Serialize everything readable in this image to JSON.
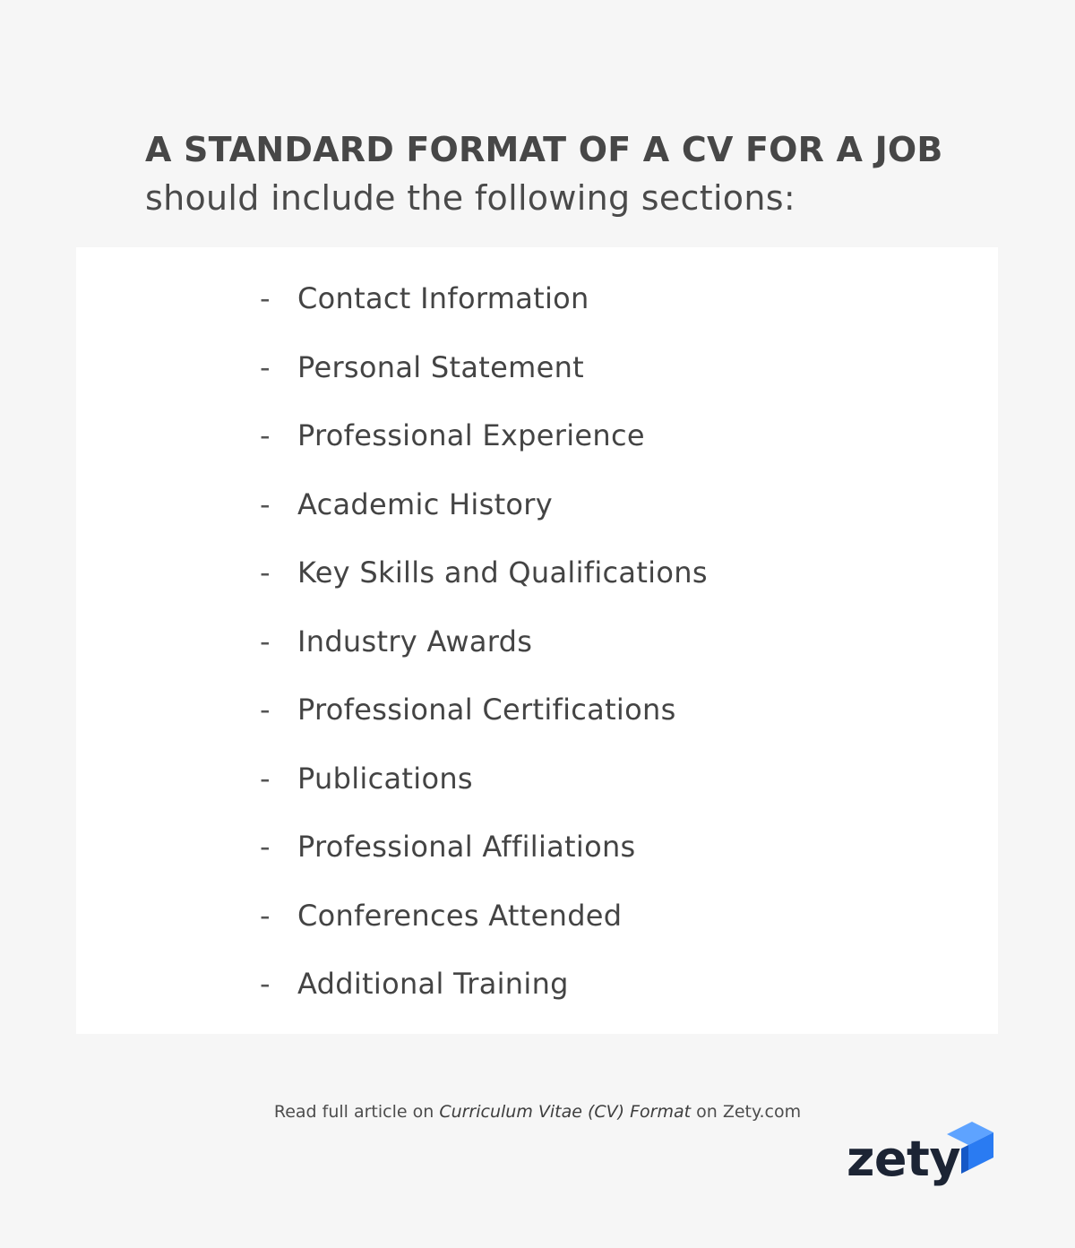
{
  "heading": "A STANDARD FORMAT OF A CV FOR A JOB",
  "subheading": "should include the following sections:",
  "bullet_symbol": "-",
  "sections": [
    "Contact Information",
    "Personal Statement",
    "Professional Experience",
    "Academic History",
    "Key Skills and Qualifications",
    "Industry Awards",
    "Professional Certifications",
    "Publications",
    "Professional Affiliations",
    "Conferences Attended",
    "Additional Training"
  ],
  "footer": {
    "prefix": "Read full article on ",
    "article_title": "Curriculum Vitae (CV) Format",
    "suffix": " on Zety.com"
  },
  "logo": {
    "text": "zety",
    "icon": "zety-logo-mark-icon",
    "colors": {
      "text": "#1c2434",
      "mark_dark": "#1558c6",
      "mark_mid": "#2a7bf2",
      "mark_light": "#5ea3ff"
    }
  },
  "colors": {
    "background": "#f6f6f6",
    "card": "#ffffff",
    "text": "#444444"
  }
}
